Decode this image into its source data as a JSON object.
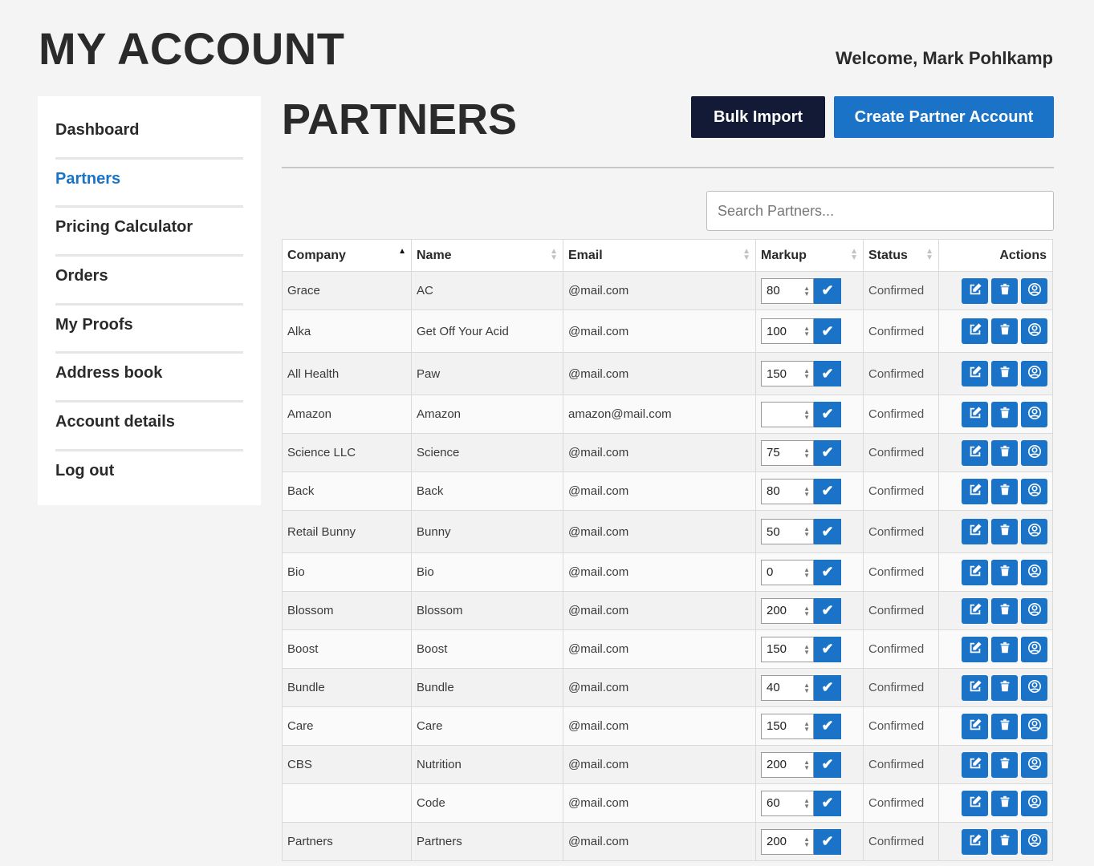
{
  "page": {
    "title": "MY ACCOUNT",
    "welcome": "Welcome, Mark Pohlkamp"
  },
  "sidebar": {
    "items": [
      {
        "label": "Dashboard"
      },
      {
        "label": "Partners"
      },
      {
        "label": "Pricing Calculator"
      },
      {
        "label": "Orders"
      },
      {
        "label": "My Proofs"
      },
      {
        "label": "Address book"
      },
      {
        "label": "Account details"
      },
      {
        "label": "Log out"
      }
    ],
    "active": "Partners"
  },
  "main": {
    "title": "PARTNERS",
    "bulk_import_label": "Bulk Import",
    "create_label": "Create Partner Account",
    "search_placeholder": "Search Partners...",
    "columns": {
      "company": "Company",
      "name": "Name",
      "email": "Email",
      "markup": "Markup",
      "status": "Status",
      "actions": "Actions"
    }
  },
  "rows": [
    {
      "company": "Grace",
      "name": "AC",
      "email": "@mail.com",
      "markup": "80",
      "status": "Confirmed"
    },
    {
      "company": "Alka",
      "name": "Get Off Your Acid",
      "email": "@mail.com",
      "markup": "100",
      "status": "Confirmed"
    },
    {
      "company": "All Health",
      "name": "Paw",
      "email": "@mail.com",
      "markup": "150",
      "status": "Confirmed"
    },
    {
      "company": "Amazon",
      "name": "Amazon",
      "email": "amazon@mail.com",
      "markup": "",
      "status": "Confirmed"
    },
    {
      "company": "Science LLC",
      "name": "Science",
      "email": "@mail.com",
      "markup": "75",
      "status": "Confirmed"
    },
    {
      "company": "Back",
      "name": "Back",
      "email": "@mail.com",
      "markup": "80",
      "status": "Confirmed"
    },
    {
      "company": "Retail Bunny",
      "name": "Bunny",
      "email": "@mail.com",
      "markup": "50",
      "status": "Confirmed"
    },
    {
      "company": "Bio",
      "name": "Bio",
      "email": "@mail.com",
      "markup": "0",
      "status": "Confirmed"
    },
    {
      "company": "Blossom",
      "name": "Blossom",
      "email": "@mail.com",
      "markup": "200",
      "status": "Confirmed"
    },
    {
      "company": "Boost",
      "name": "Boost",
      "email": "@mail.com",
      "markup": "150",
      "status": "Confirmed"
    },
    {
      "company": "Bundle",
      "name": "Bundle",
      "email": "@mail.com",
      "markup": "40",
      "status": "Confirmed"
    },
    {
      "company": "Care",
      "name": "Care",
      "email": "@mail.com",
      "markup": "150",
      "status": "Confirmed"
    },
    {
      "company": "CBS",
      "name": "Nutrition",
      "email": "@mail.com",
      "markup": "200",
      "status": "Confirmed"
    },
    {
      "company": "",
      "name": "Code",
      "email": "@mail.com",
      "markup": "60",
      "status": "Confirmed"
    },
    {
      "company": "Partners",
      "name": "Partners",
      "email": "@mail.com",
      "markup": "200",
      "status": "Confirmed"
    }
  ],
  "icons": {
    "edit": "edit-icon",
    "delete": "trash-icon",
    "login_as": "user-circle-icon",
    "confirm": "check-icon"
  },
  "colors": {
    "accent": "#1a73c7",
    "dark_button": "#121a36"
  }
}
